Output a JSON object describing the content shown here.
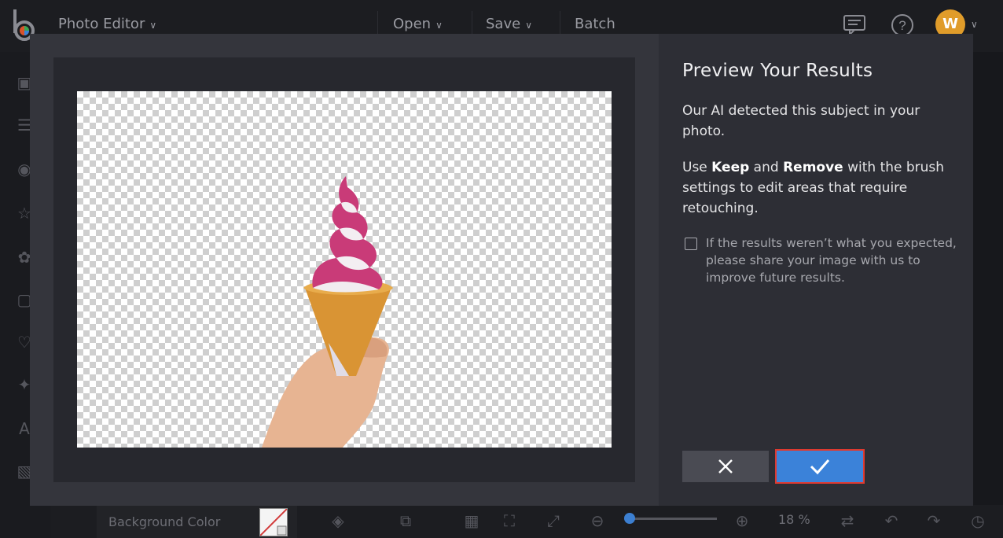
{
  "topbar": {
    "app_title": "Photo Editor",
    "menus": [
      {
        "label": "Open"
      },
      {
        "label": "Save"
      },
      {
        "label": "Batch"
      }
    ],
    "icons": [
      "chat-icon",
      "help-icon"
    ],
    "avatar_initial": "W"
  },
  "sidebar": {
    "icons": [
      "image-icon",
      "sliders-icon",
      "eye-icon",
      "star-icon",
      "effects-icon",
      "frame-icon",
      "heart-icon",
      "overlay-icon",
      "text-icon",
      "texture-icon"
    ]
  },
  "bottombar": {
    "background_color_label": "Background Color",
    "zoom_level": "18 %",
    "zoom_fraction": 0.05
  },
  "modal": {
    "title": "Preview Your Results",
    "para1": "Our AI detected this subject in your photo.",
    "para2_parts": [
      "Use ",
      "Keep",
      " and ",
      "Remove",
      " with the brush settings to edit areas that require retouching."
    ],
    "checkbox_label": "If the results weren’t what you expected, please share your image with us to improve future results.",
    "checkbox_checked": false,
    "cancel_icon": "close-icon",
    "confirm_icon": "checkmark-icon"
  },
  "colors": {
    "accent": "#3b82d9",
    "highlight_border": "#e03a30",
    "avatar": "#e09c2a"
  }
}
